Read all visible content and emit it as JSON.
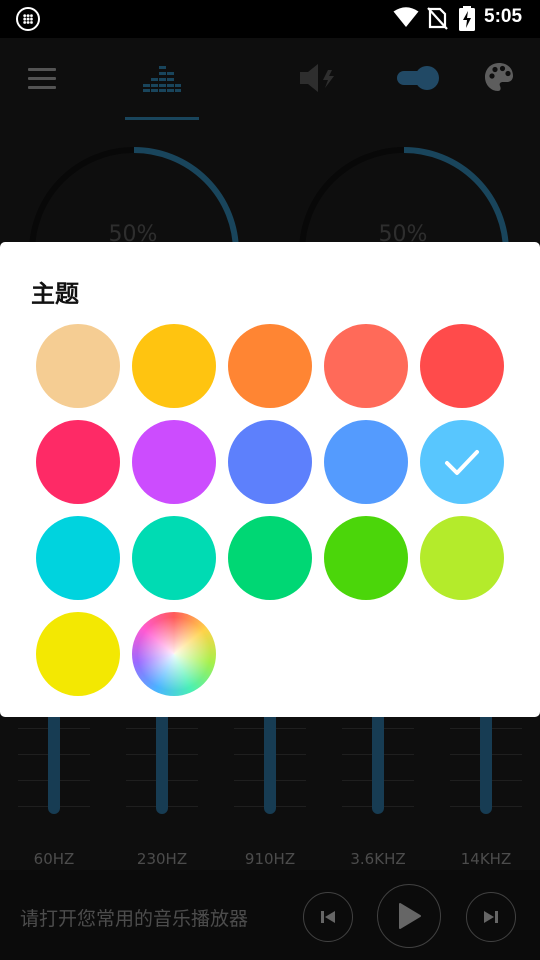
{
  "status_bar": {
    "time": "5:05"
  },
  "toolbar": {
    "tabs": [
      "menu",
      "equalizer",
      "volume-boost",
      "toggle",
      "theme"
    ],
    "accent": "#2f7fa8"
  },
  "knobs": [
    {
      "label": "50%",
      "level": 0.5
    },
    {
      "label": "50%",
      "level": 0.5
    }
  ],
  "equalizer": {
    "bands": [
      "60HZ",
      "230HZ",
      "910HZ",
      "3.6KHZ",
      "14KHZ"
    ]
  },
  "player": {
    "prompt": "请打开您常用的音乐播放器"
  },
  "dialog": {
    "title": "主题",
    "swatches": [
      {
        "color": "#f5cd93",
        "selected": false
      },
      {
        "color": "#ffc410",
        "selected": false
      },
      {
        "color": "#ff8533",
        "selected": false
      },
      {
        "color": "#ff6a59",
        "selected": false
      },
      {
        "color": "#ff4b4b",
        "selected": false
      },
      {
        "color": "#fe2a66",
        "selected": false
      },
      {
        "color": "#cc4cfe",
        "selected": false
      },
      {
        "color": "#5d80fc",
        "selected": false
      },
      {
        "color": "#549bfe",
        "selected": false
      },
      {
        "color": "#58c6fe",
        "selected": true
      },
      {
        "color": "#00d3de",
        "selected": false
      },
      {
        "color": "#00dbb3",
        "selected": false
      },
      {
        "color": "#00d774",
        "selected": false
      },
      {
        "color": "#4bd60a",
        "selected": false
      },
      {
        "color": "#b4eb2b",
        "selected": false
      },
      {
        "color": "#f3e802",
        "selected": false
      },
      {
        "color": "custom-color-wheel",
        "selected": false
      }
    ]
  }
}
